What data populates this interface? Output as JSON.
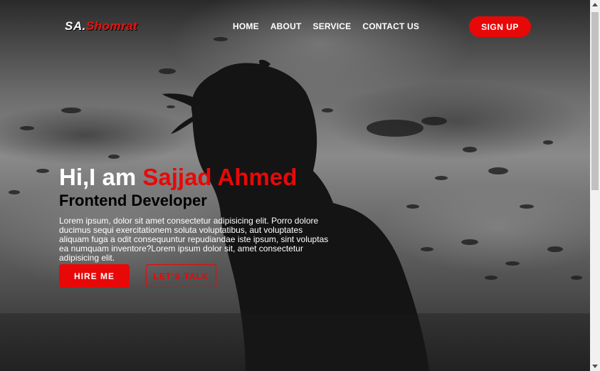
{
  "logo": {
    "prefix": "SA.",
    "name": "Shomrat"
  },
  "nav": {
    "items": [
      {
        "label": "HOME"
      },
      {
        "label": "ABOUT"
      },
      {
        "label": "SERVICE"
      },
      {
        "label": "CONTACT US"
      }
    ],
    "signup_label": "SIGN UP"
  },
  "hero": {
    "greeting": "Hi,I am ",
    "name": "Sajjad Ahmed",
    "subtitle": "Frontend Developer",
    "description": "Lorem ipsum, dolor sit amet consectetur adipisicing elit. Porro dolore ducimus sequi exercitationem soluta voluptatibus, aut voluptates aliquam fuga a odit consequuntur repudiandae iste ipsum, sint voluptas ea numquam inventore?Lorem ipsum dolor sit, amet consectetur adipisicing elit.",
    "hire_label": "HIRE ME",
    "talk_label": "LET'S TALK"
  },
  "colors": {
    "accent": "#e80808",
    "text": "#ffffff",
    "subtitle": "#000000"
  }
}
